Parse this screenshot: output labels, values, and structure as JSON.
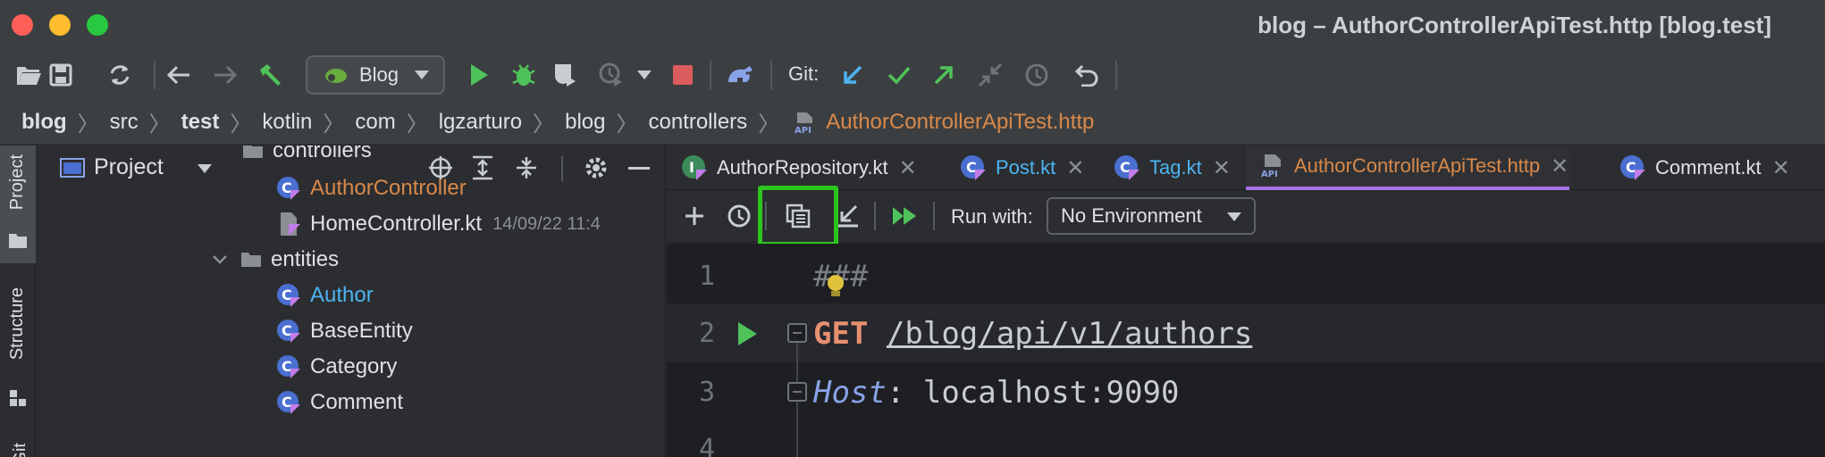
{
  "window": {
    "title": "blog – AuthorControllerApiTest.http [blog.test]"
  },
  "toolbar": {
    "run_config": "Blog",
    "git_label": "Git:"
  },
  "breadcrumb": {
    "items": [
      "blog",
      "src",
      "test",
      "kotlin",
      "com",
      "lgzarturo",
      "blog",
      "controllers"
    ],
    "file": "AuthorControllerApiTest.http"
  },
  "stripe": {
    "project": "Project",
    "structure": "Structure"
  },
  "project_panel": {
    "title": "Project",
    "tree": [
      {
        "name": "controllers",
        "kind": "folder"
      },
      {
        "name": "AuthorController",
        "kind": "class",
        "color": "#d9894a"
      },
      {
        "name": "HomeController.kt",
        "kind": "file",
        "meta": "14/09/22 11:4"
      },
      {
        "name": "entities",
        "kind": "folder"
      },
      {
        "name": "Author",
        "kind": "class",
        "color": "#4db4f2"
      },
      {
        "name": "BaseEntity",
        "kind": "class"
      },
      {
        "name": "Category",
        "kind": "class"
      },
      {
        "name": "Comment",
        "kind": "class"
      }
    ]
  },
  "editor": {
    "tabs": [
      {
        "label": "AuthorRepository.kt",
        "color": "#dfe1e5"
      },
      {
        "label": "Post.kt",
        "color": "#4db4f2"
      },
      {
        "label": "Tag.kt",
        "color": "#4db4f2"
      },
      {
        "label": "AuthorControllerApiTest.http",
        "color": "#d9894a",
        "active": true
      },
      {
        "label": "Comment.kt",
        "color": "#dfe1e5"
      }
    ],
    "run_with_label": "Run with:",
    "environment": "No Environment",
    "lines": [
      {
        "num": "1",
        "text": "###"
      },
      {
        "num": "2",
        "method": "GET",
        "url": "/blog/api/v1/authors"
      },
      {
        "num": "3",
        "header": "Host",
        "colon": ": ",
        "value": "localhost:9090"
      },
      {
        "num": "4"
      }
    ]
  },
  "colors": {
    "accent": "#a571e6",
    "highlight": "#2ec41e",
    "run_green": "#4fc35a"
  }
}
